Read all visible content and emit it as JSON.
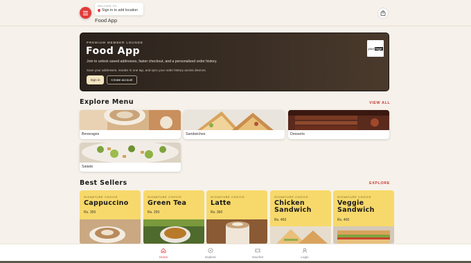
{
  "header": {
    "deliver_caption": "DELIVER TO",
    "location": "Sign in to add location",
    "app_name": "Food App"
  },
  "hero": {
    "caption": "PREMIUM MEMBER LOUNGE",
    "title": "Food App",
    "subtitle": "Join to unlock saved addresses, faster checkout, and a personalized order history.",
    "note": "Save your addresses, reorder in one tap, and sync your order history across devices.",
    "signin_label": "Sign in",
    "create_label": "Create account",
    "logo_text_left": "your",
    "logo_text_right": "logo"
  },
  "explore": {
    "title": "Explore Menu",
    "link": "VIEW ALL",
    "categories": [
      {
        "label": "Beverages"
      },
      {
        "label": "Sandwiches"
      },
      {
        "label": "Desserts"
      },
      {
        "label": "Salads"
      }
    ]
  },
  "bestsellers": {
    "title": "Best Sellers",
    "link": "EXPLORE",
    "items": [
      {
        "caption": "SIGNATURE CHOICE",
        "name": "Cappuccino",
        "price": "Rs. 350"
      },
      {
        "caption": "SIGNATURE CHOICE",
        "name": "Green Tea",
        "price": "Rs. 250"
      },
      {
        "caption": "SIGNATURE CHOICE",
        "name": "Latte",
        "price": "Rs. 360"
      },
      {
        "caption": "SIGNATURE CHOICE",
        "name": "Chicken Sandwich",
        "price": "Rs. 450"
      },
      {
        "caption": "SIGNATURE CHOICE",
        "name": "Veggie Sandwich",
        "price": "Rs. 400"
      }
    ]
  },
  "nav": {
    "items": [
      {
        "label": "Home",
        "icon": "home-icon",
        "active": true
      },
      {
        "label": "Explore",
        "icon": "compass-icon",
        "active": false
      },
      {
        "label": "Voucher",
        "icon": "ticket-icon",
        "active": false
      },
      {
        "label": "Login",
        "icon": "user-icon",
        "active": false
      }
    ]
  },
  "colors": {
    "accent": "#e23b3b",
    "background": "#f6f1ea",
    "card_yellow": "#f7d96b",
    "hero_dark": "#2a221c"
  }
}
